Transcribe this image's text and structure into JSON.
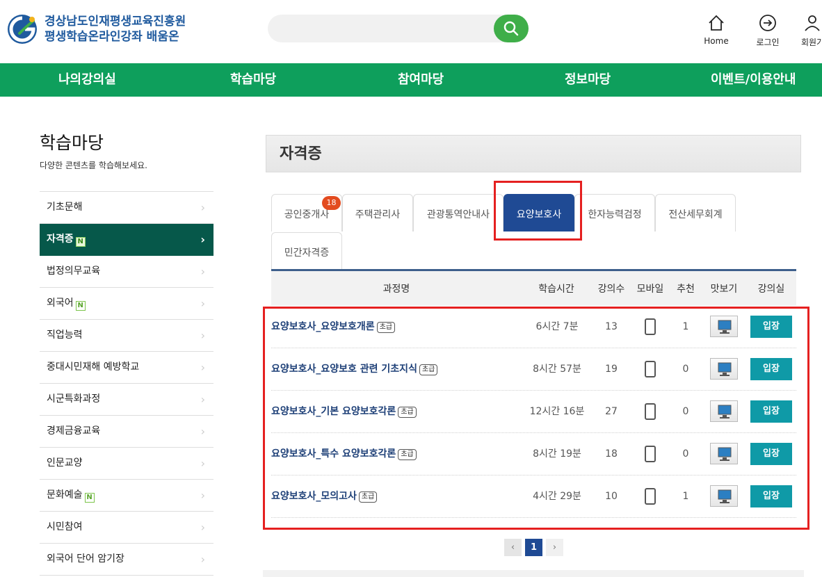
{
  "header": {
    "logo_line1": "경상남도인재평생교육진흥원",
    "logo_line2": "평생학습온라인강좌 배움온",
    "search_placeholder": "",
    "utils": [
      {
        "label": "Home",
        "icon": "home-icon"
      },
      {
        "label": "로그인",
        "icon": "login-icon"
      },
      {
        "label": "회원가입",
        "icon": "user-icon"
      }
    ]
  },
  "nav": [
    "나의강의실",
    "학습마당",
    "참여마당",
    "정보마당",
    "이벤트/이용안내"
  ],
  "sidebar": {
    "title": "학습마당",
    "subtitle": "다양한 콘텐츠를 학습해보세요.",
    "items": [
      {
        "label": "기초문해",
        "new": ""
      },
      {
        "label": "자격증",
        "new": "N"
      },
      {
        "label": "법정의무교육",
        "new": ""
      },
      {
        "label": "외국어",
        "new": "N"
      },
      {
        "label": "직업능력",
        "new": ""
      },
      {
        "label": "중대시민재해 예방학교",
        "new": ""
      },
      {
        "label": "시군특화과정",
        "new": ""
      },
      {
        "label": "경제금융교육",
        "new": ""
      },
      {
        "label": "인문교양",
        "new": ""
      },
      {
        "label": "문화예술",
        "new": "N"
      },
      {
        "label": "시민참여",
        "new": ""
      },
      {
        "label": "외국어 단어 암기장",
        "new": ""
      }
    ],
    "chevron": "›"
  },
  "main": {
    "title": "자격증",
    "tabs": [
      "공인중개사",
      "주택관리사",
      "관광통역안내사",
      "요양보호사",
      "한자능력검정",
      "전산세무회계",
      "민간자격증"
    ],
    "tab_badge": "18",
    "columns": [
      "과정명",
      "학습시간",
      "강의수",
      "모바일",
      "추천",
      "맛보기",
      "강의실"
    ],
    "level_label": "초급",
    "enter_label": "입장",
    "courses": [
      {
        "name": "요양보호사_요양보호개론",
        "time": "6시간 7분",
        "lectures": "13",
        "recommend": "1"
      },
      {
        "name": "요양보호사_요양보호 관련 기초지식",
        "time": "8시간 57분",
        "lectures": "19",
        "recommend": "0"
      },
      {
        "name": "요양보호사_기본 요양보호각론",
        "time": "12시간 16분",
        "lectures": "27",
        "recommend": "0"
      },
      {
        "name": "요양보호사_특수 요양보호각론",
        "time": "8시간 19분",
        "lectures": "18",
        "recommend": "0"
      },
      {
        "name": "요양보호사_모의고사",
        "time": "4시간 29분",
        "lectures": "10",
        "recommend": "1"
      }
    ],
    "pager": {
      "prev": "‹",
      "current": "1",
      "next": "›"
    }
  },
  "colors": {
    "nav_green": "#0e9f5c",
    "sidebar_active": "#06584a",
    "tab_active": "#1f4a94",
    "enter_button": "#0f9aa7",
    "highlight": "#e52020"
  }
}
